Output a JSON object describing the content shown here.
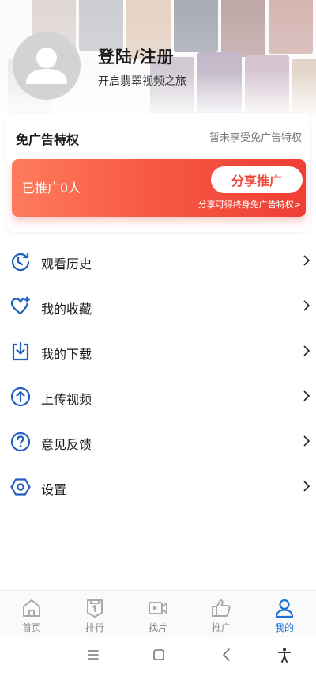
{
  "profile": {
    "title": "登陆/注册",
    "subtitle": "开启翡翠视频之旅",
    "avatar_icon": "default-user-avatar"
  },
  "ad_free": {
    "title": "免广告特权",
    "status": "暂未享受免广告特权",
    "promoted_count": "已推广0人",
    "share_button": "分享推广",
    "share_hint": "分享可得终身免广告特权>",
    "gradient_start": "#ff7b5c",
    "gradient_end": "#ef3e34"
  },
  "menu": {
    "items": [
      {
        "label": "观看历史",
        "icon": "history-icon"
      },
      {
        "label": "我的收藏",
        "icon": "favorite-heart-icon"
      },
      {
        "label": "我的下载",
        "icon": "download-icon"
      },
      {
        "label": "上传视频",
        "icon": "upload-icon"
      },
      {
        "label": "意见反馈",
        "icon": "feedback-question-icon"
      },
      {
        "label": "设置",
        "icon": "settings-icon"
      }
    ]
  },
  "tabbar": {
    "active_color": "#1f73d6",
    "inactive_color": "#888888",
    "items": [
      {
        "label": "首页",
        "icon": "home-icon",
        "active": false
      },
      {
        "label": "排行",
        "icon": "ranking-icon",
        "active": false
      },
      {
        "label": "找片",
        "icon": "video-camera-icon",
        "active": false
      },
      {
        "label": "推广",
        "icon": "thumbs-up-icon",
        "active": false
      },
      {
        "label": "我的",
        "icon": "user-icon",
        "active": true
      }
    ]
  },
  "system_nav": {
    "items": [
      "menu-lines-icon",
      "home-square-icon",
      "back-chevron-icon",
      "accessibility-icon"
    ]
  },
  "colors": {
    "accent": "#1f73d6",
    "promo_red": "#f14a3c"
  }
}
